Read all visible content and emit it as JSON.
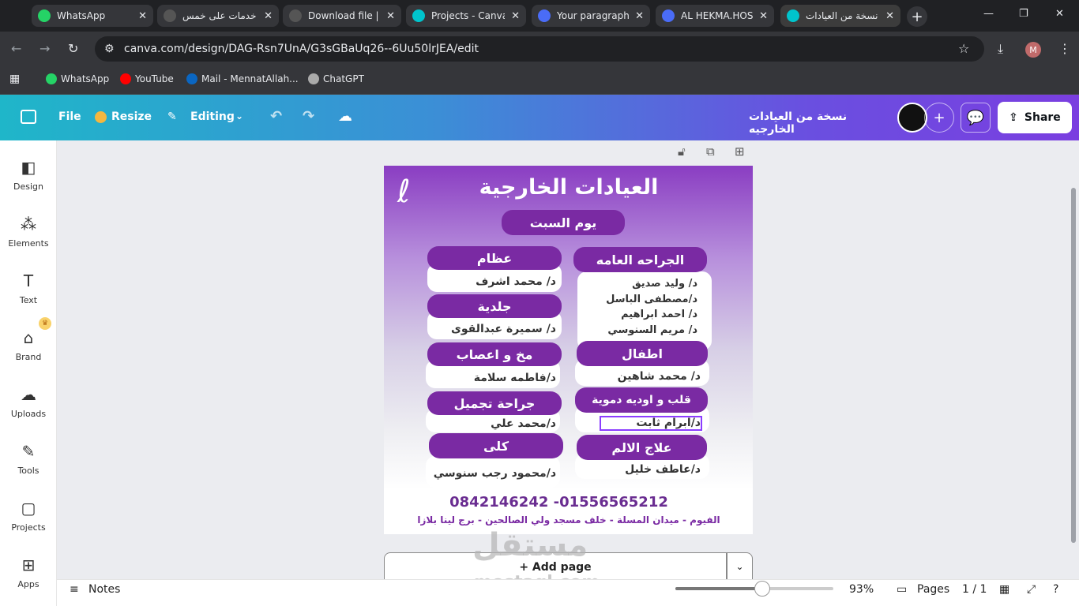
{
  "browser": {
    "tabs": [
      {
        "label": "WhatsApp",
        "icon": "whatsapp-icon",
        "color": "#25d366"
      },
      {
        "label": "خدمات على خمس",
        "icon": "chatgpt-icon",
        "color": "#555555"
      },
      {
        "label": "Download file | ",
        "icon": "globe-icon",
        "color": "#555555"
      },
      {
        "label": "Projects - Canva",
        "icon": "canva-icon",
        "color": "#00c4cc"
      },
      {
        "label": "Your paragraph",
        "icon": "heart-icon",
        "color": "#4a6cf7"
      },
      {
        "label": "AL HEKMA.HOS",
        "icon": "heart-icon",
        "color": "#4a6cf7"
      },
      {
        "label": "نسخة من العيادات",
        "icon": "canva-icon",
        "color": "#00c4cc"
      }
    ],
    "url": "canva.com/design/DAG-Rsn7UnA/G3sGBaUq26--6Uu50lrJEA/edit",
    "profile_initial": "M",
    "bookmarks": [
      {
        "label": "WhatsApp",
        "color": "#25d366"
      },
      {
        "label": "YouTube",
        "color": "#ff0000"
      },
      {
        "label": "Mail - MennatAllah...",
        "color": "#0a66c2"
      },
      {
        "label": "ChatGPT",
        "color": "#aaaaaa"
      }
    ]
  },
  "canva_toolbar": {
    "file": "File",
    "resize": "Resize",
    "editing": "Editing",
    "design_title": "نسخة من العيادات الخارجيه",
    "share": "Share"
  },
  "sidebar": {
    "items": [
      {
        "label": "Design",
        "icon": "design-icon"
      },
      {
        "label": "Elements",
        "icon": "elements-icon"
      },
      {
        "label": "Text",
        "icon": "text-icon"
      },
      {
        "label": "Brand",
        "icon": "brand-icon"
      },
      {
        "label": "Uploads",
        "icon": "uploads-icon"
      },
      {
        "label": "Tools",
        "icon": "tools-icon"
      },
      {
        "label": "Projects",
        "icon": "projects-icon"
      },
      {
        "label": "Apps",
        "icon": "apps-icon"
      }
    ]
  },
  "design": {
    "title": "العيادات الخارجية",
    "day": "يوم السبت",
    "clinics": {
      "bones": "عظام",
      "bones_doc": "د/ محمد اشرف",
      "derma": "جلدية",
      "derma_doc": "د/ سميرة عبدالقوى",
      "neuro": "مخ و اعصاب",
      "neuro_doc": "د/فاطمه سلامة",
      "plastic": "جراحة تجميل",
      "plastic_doc": "د/محمد علي",
      "kidney": "كلى",
      "kidney_doc": "د/محمود رجب سنوسي",
      "surgery": "الجراحه العامه",
      "surgery_docs": [
        "د/ وليد صديق",
        "د/مصطفى الباسل",
        "د/ احمد ابراهيم",
        "د/ مريم السنوسي"
      ],
      "peds": "اطفال",
      "peds_doc": "د/ محمد شاهين",
      "cardio": "قلب و اوديه دموية",
      "cardio_doc": "د/ابرام ثابت",
      "pain": "علاج الالم",
      "pain_doc": "د/عاطف خليل"
    },
    "phones": "0842146242 -01556565212",
    "address": "الفيوم - ميدان المسلة - خلف مسجد ولي الصالحين - برج لينا بلازا"
  },
  "add_page": "+ Add page",
  "bottom": {
    "notes": "Notes",
    "zoom_pct": "93%",
    "zoom_value": 0.55,
    "pages_label": "Pages",
    "pages_count": "1 / 1"
  },
  "watermark": {
    "ar": "مستقل",
    "en": "mostaql.com"
  }
}
